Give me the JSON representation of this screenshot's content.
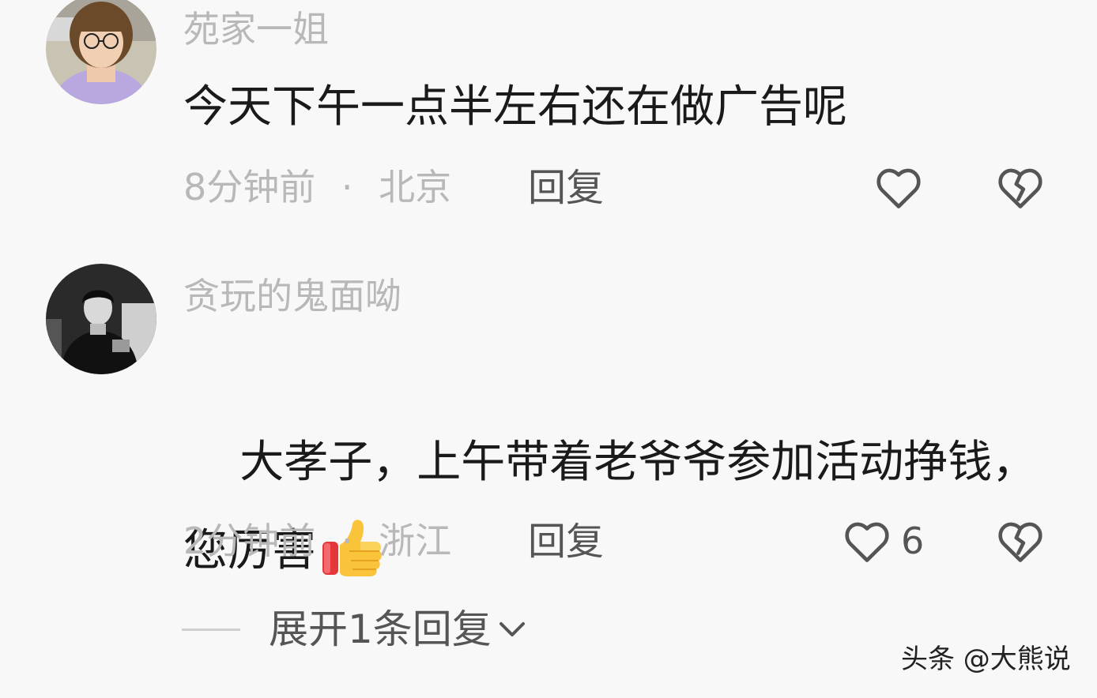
{
  "comments": [
    {
      "username": "苑家一姐",
      "text": "今天下午一点半左右还在做广告呢",
      "time": "8分钟前",
      "separator": "·",
      "location": "北京",
      "reply_label": "回复",
      "like_count": ""
    },
    {
      "username": "贪玩的鬼面呦",
      "text": "大孝子，上午带着老爷爷参加活动挣钱，您厉害",
      "emoji": "thumbs-up",
      "time": "2分钟前",
      "separator": "·",
      "location": "浙江",
      "reply_label": "回复",
      "like_count": "6"
    }
  ],
  "expand_replies": {
    "label": "展开1条回复"
  },
  "watermark": {
    "text": "头条 @大熊说"
  },
  "icons": {
    "like": "heart-outline-icon",
    "dislike": "broken-heart-icon",
    "expand": "chevron-down-icon",
    "emoji": "thumbs-up-icon"
  },
  "colors": {
    "background": "#f8f8f8",
    "text": "#1a1a1a",
    "meta": "#b8b8b8",
    "action": "#555555"
  }
}
